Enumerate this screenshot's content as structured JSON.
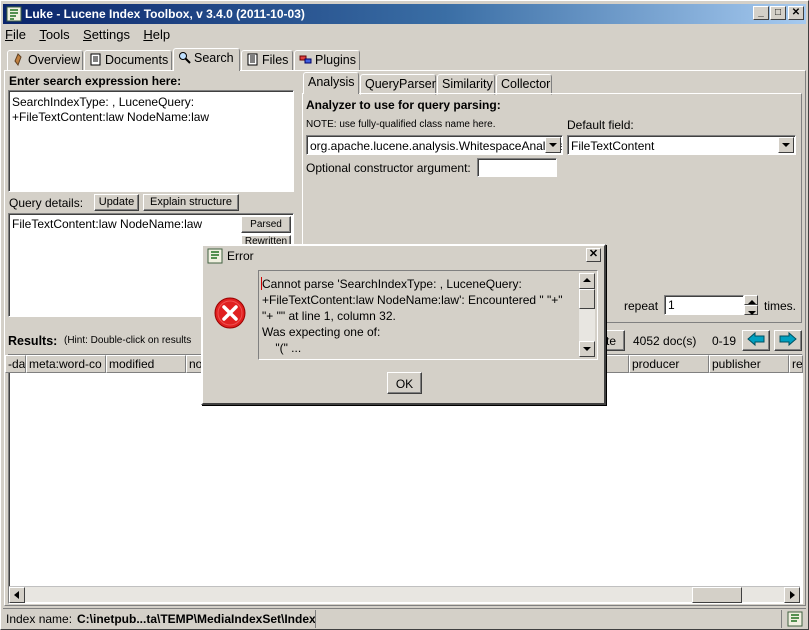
{
  "window": {
    "title": "Luke - Lucene Index Toolbox, v 3.4.0 (2011-10-03)",
    "minimize": "_",
    "maximize": "□",
    "close": "✕"
  },
  "menu": [
    "File",
    "Tools",
    "Settings",
    "Help"
  ],
  "main_tabs": [
    {
      "label": "Overview",
      "icon": "overview-icon"
    },
    {
      "label": "Documents",
      "icon": "documents-icon"
    },
    {
      "label": "Search",
      "icon": "search-icon"
    },
    {
      "label": "Files",
      "icon": "files-icon"
    },
    {
      "label": "Plugins",
      "icon": "plugins-icon"
    }
  ],
  "search": {
    "expression_label": "Enter search expression here:",
    "expression_lines": [
      "SearchIndexType: , LuceneQuery:",
      "+FileTextContent:law NodeName:law"
    ],
    "query_details_label": "Query details:",
    "update_button": "Update",
    "explain_button": "Explain structure",
    "parsed_query": "FileTextContent:law NodeName:law",
    "parsed_button": "Parsed",
    "rewritten_button": "Rewritten"
  },
  "analysis": {
    "tabs": [
      "Analysis",
      "QueryParser",
      "Similarity",
      "Collector"
    ],
    "heading": "Analyzer to use for query parsing:",
    "note": "NOTE: use fully-qualified class name here.",
    "analyzer_value": "org.apache.lucene.analysis.WhitespaceAnalyzer",
    "default_field_label": "Default field:",
    "default_field_value": "FileTextContent",
    "ctor_label": "Optional constructor argument:",
    "ctor_value": ""
  },
  "repeat": {
    "label": "repeat",
    "value": "1",
    "suffix": "times."
  },
  "results": {
    "label": "Results:",
    "hint": "(Hint: Double-click on results",
    "delete_button": "te",
    "doc_count": "4052 doc(s)",
    "range": "0-19",
    "columns": [
      "-dat",
      "meta:word-co",
      "modified",
      "no",
      "producer",
      "publisher",
      "res"
    ]
  },
  "status": {
    "index_label": "Index name:",
    "index_path": "C:\\inetpub...ta\\TEMP\\MediaIndexSet\\Index"
  },
  "dialog": {
    "title": "Error",
    "message_lines": [
      "Cannot parse 'SearchIndexType: , LuceneQuery:",
      "+FileTextContent:law NodeName:law': Encountered \" \"+\"",
      "\"+ \"\" at line 1, column 32.",
      "Was expecting one of:",
      "    \"(\" ..."
    ],
    "ok_button": "OK"
  },
  "colors": {
    "title_start": "#0a246a",
    "title_end": "#a6caf0",
    "error_red": "#e02020",
    "face": "#d4d0c8"
  }
}
